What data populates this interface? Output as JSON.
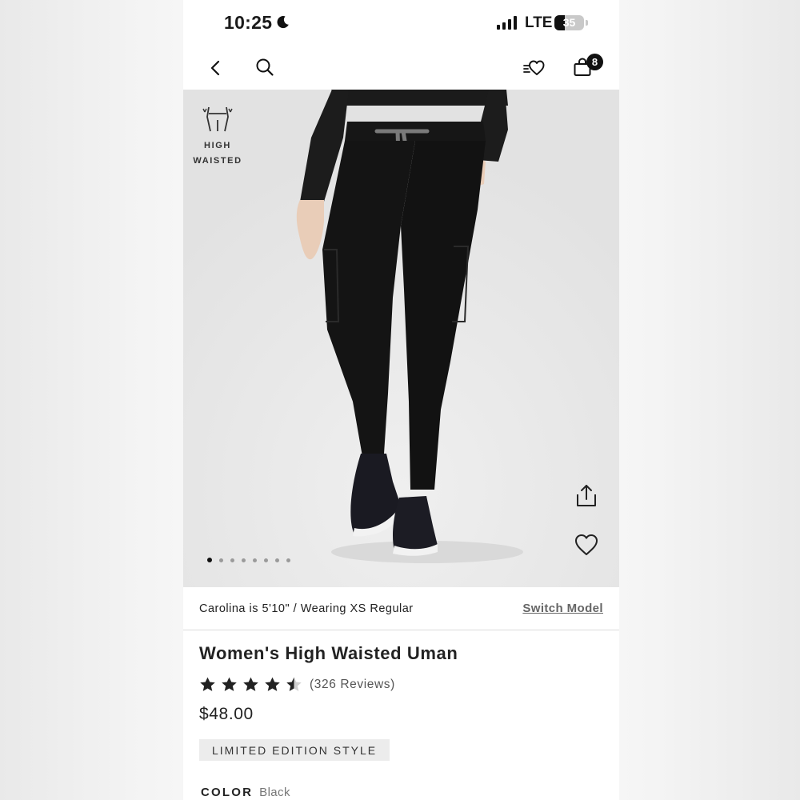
{
  "status_bar": {
    "time": "10:25",
    "network": "LTE",
    "battery_percent": "35",
    "battery_level": 0.35
  },
  "nav": {
    "icons": [
      "back-icon",
      "search-icon",
      "wishlist-icon",
      "bag-icon"
    ],
    "cart_count": "8"
  },
  "hero": {
    "badge_line1": "HIGH",
    "badge_line2": "WAISTED",
    "carousel_total": 8,
    "carousel_active": 1,
    "icons": [
      "share-icon",
      "heart-icon"
    ]
  },
  "model": {
    "info": "Carolina is 5'10\" / Wearing XS Regular",
    "switch_label": "Switch Model"
  },
  "product": {
    "title": "Women's High Waisted Uman",
    "rating": 4.5,
    "reviews": "(326 Reviews)",
    "price": "$48.00",
    "tag": "LIMITED EDITION STYLE",
    "color_label": "COLOR",
    "color_value": "Black"
  },
  "colors": {
    "text": "#1a1a1a",
    "image_bg": "#e8e8e8",
    "tag_bg": "#ececec",
    "badge": "#111111"
  }
}
